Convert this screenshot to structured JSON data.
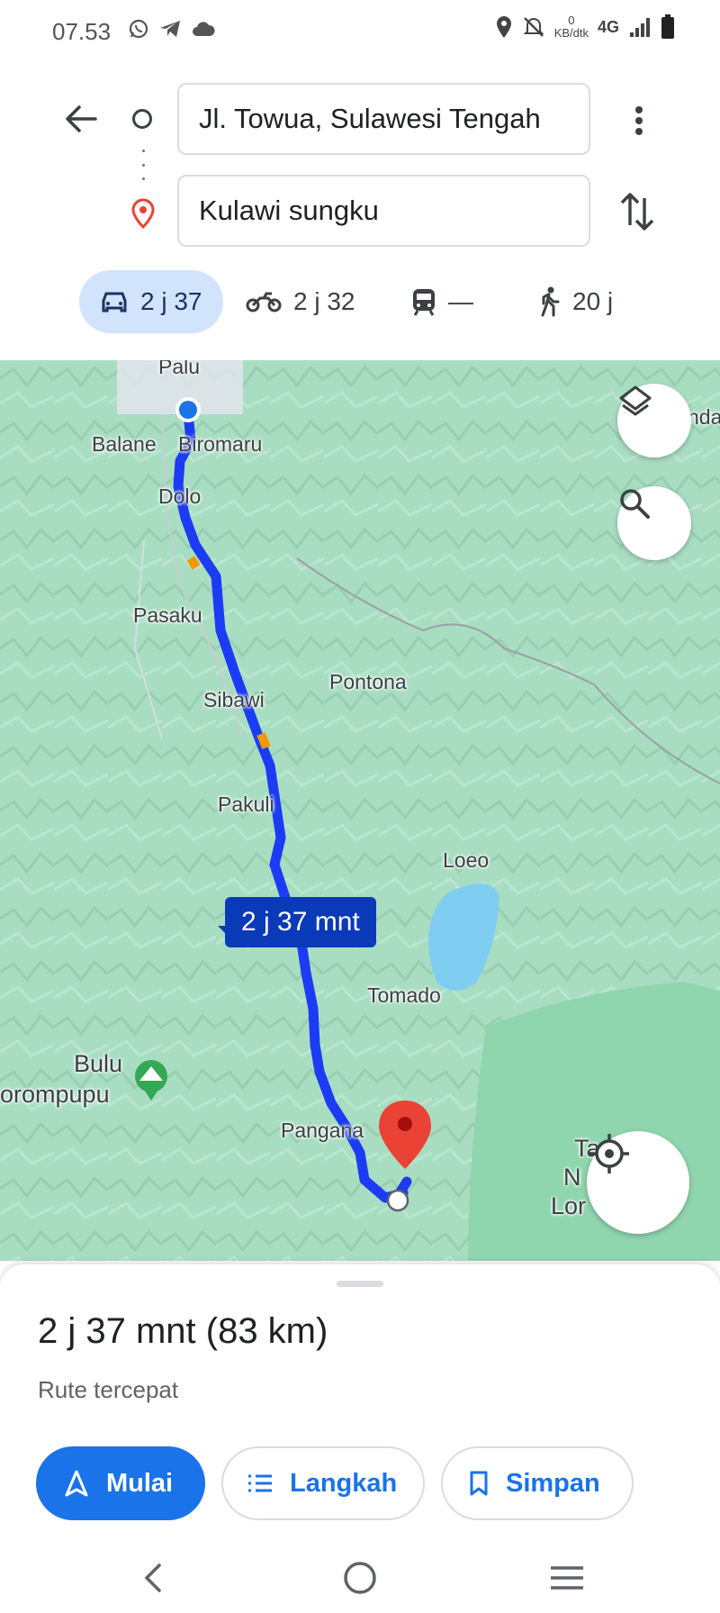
{
  "status_bar": {
    "time": "07.53",
    "netspeed_value": "0",
    "netspeed_unit": "KB/dtk",
    "network": "4G"
  },
  "search": {
    "origin": "Jl. Towua, Sulawesi Tengah",
    "destination": "Kulawi sungku"
  },
  "travel_modes": [
    {
      "mode": "car",
      "icon": "car-icon",
      "label": "2 j 37",
      "active": true
    },
    {
      "mode": "motorcycle",
      "icon": "motorcycle-icon",
      "label": "2 j 32",
      "active": false
    },
    {
      "mode": "transit",
      "icon": "train-icon",
      "label": "—",
      "active": false
    },
    {
      "mode": "walk",
      "icon": "walking-icon",
      "label": "20 j",
      "active": false
    }
  ],
  "map": {
    "route_duration_callout": "2 j 37 mnt",
    "labels": {
      "palu": "Palu",
      "balane": "Balane",
      "biromaru": "Biromaru",
      "dolo": "Dolo",
      "pasaku": "Pasaku",
      "pontona": "Pontona",
      "sibawi": "Sibawi",
      "pakuli": "Pakuli",
      "loeo": "Loeo",
      "tomado": "Tomado",
      "bulu": "Bulu",
      "orompupu": "orompupu",
      "pangana": "Pangana",
      "nda": "nda",
      "ta": "Ta",
      "n": "N",
      "lor": "Lor"
    },
    "colors": {
      "route": "#1b3cf4",
      "route_traffic": "#f29900",
      "water": "#7fcdf0",
      "land": "#a7dcc0",
      "park": "#8fd5ae",
      "destination_pin": "#ea4335"
    }
  },
  "route_summary": {
    "title": "2 j 37 mnt (83 km)",
    "subtitle": "Rute tercepat"
  },
  "actions": {
    "start": "Mulai",
    "steps": "Langkah",
    "save": "Simpan"
  }
}
